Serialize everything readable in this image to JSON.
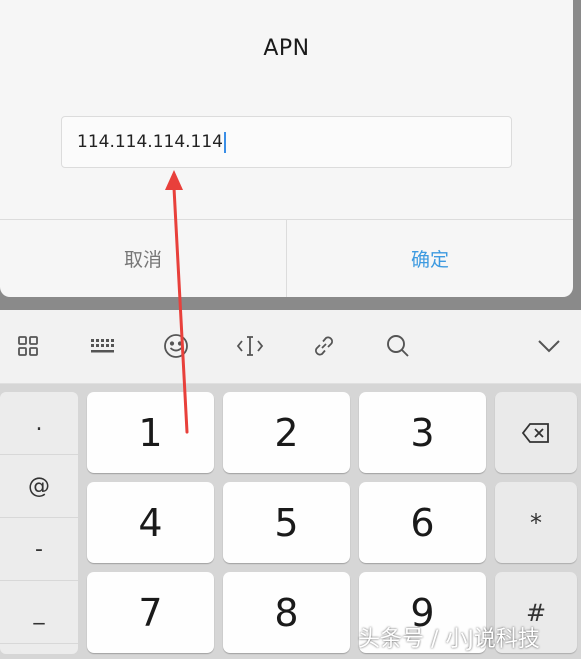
{
  "dialog": {
    "title": "APN",
    "input_value": "114.114.114.114",
    "cancel_label": "取消",
    "confirm_label": "确定",
    "confirm_color": "#3d9ae0"
  },
  "keyboard": {
    "toolbar_icons": [
      "grid-icon",
      "keyboard-icon",
      "emoji-icon",
      "cursor-move-icon",
      "link-icon",
      "search-icon",
      "chevron-down-icon"
    ],
    "symbols": [
      ".",
      "@",
      "-",
      "_"
    ],
    "keys": [
      "1",
      "2",
      "3",
      "4",
      "5",
      "6",
      "7",
      "8",
      "9"
    ],
    "right_keys": [
      "backspace-icon",
      "*",
      "#"
    ]
  },
  "annotation": {
    "arrow_color": "#e8403b"
  },
  "watermark": "头条号 / 小J说科技"
}
